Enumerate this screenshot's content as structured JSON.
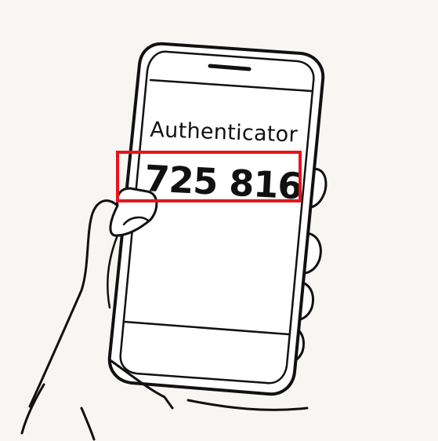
{
  "screen": {
    "app_title": "Authenticator",
    "code": "725 816"
  },
  "colors": {
    "background": "#f7f6f3",
    "line": "#111111",
    "highlight": "#e8141b"
  },
  "icons": [
    "phone-speaker-icon"
  ]
}
